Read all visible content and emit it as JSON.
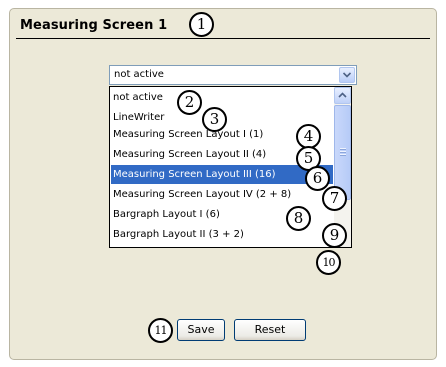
{
  "panel": {
    "title": "Measuring Screen 1"
  },
  "combo": {
    "value": "not active"
  },
  "list": {
    "items": [
      "not active",
      "LineWriter",
      "Measuring Screen Layout I   (1)",
      "Measuring Screen Layout II  (4)",
      "Measuring Screen Layout III (16)",
      "Measuring Screen Layout IV  (2 + 8)",
      "Bargraph Layout I   (6)",
      "Bargraph Layout II  (3 + 2)"
    ],
    "selected_index": 4
  },
  "callouts": [
    "1",
    "2",
    "3",
    "4",
    "5",
    "6",
    "7",
    "8",
    "9",
    "10",
    "11"
  ],
  "buttons": {
    "save": "Save",
    "reset": "Reset"
  },
  "colors": {
    "selection": "#316ac5",
    "panel_bg": "#ece9d8"
  }
}
